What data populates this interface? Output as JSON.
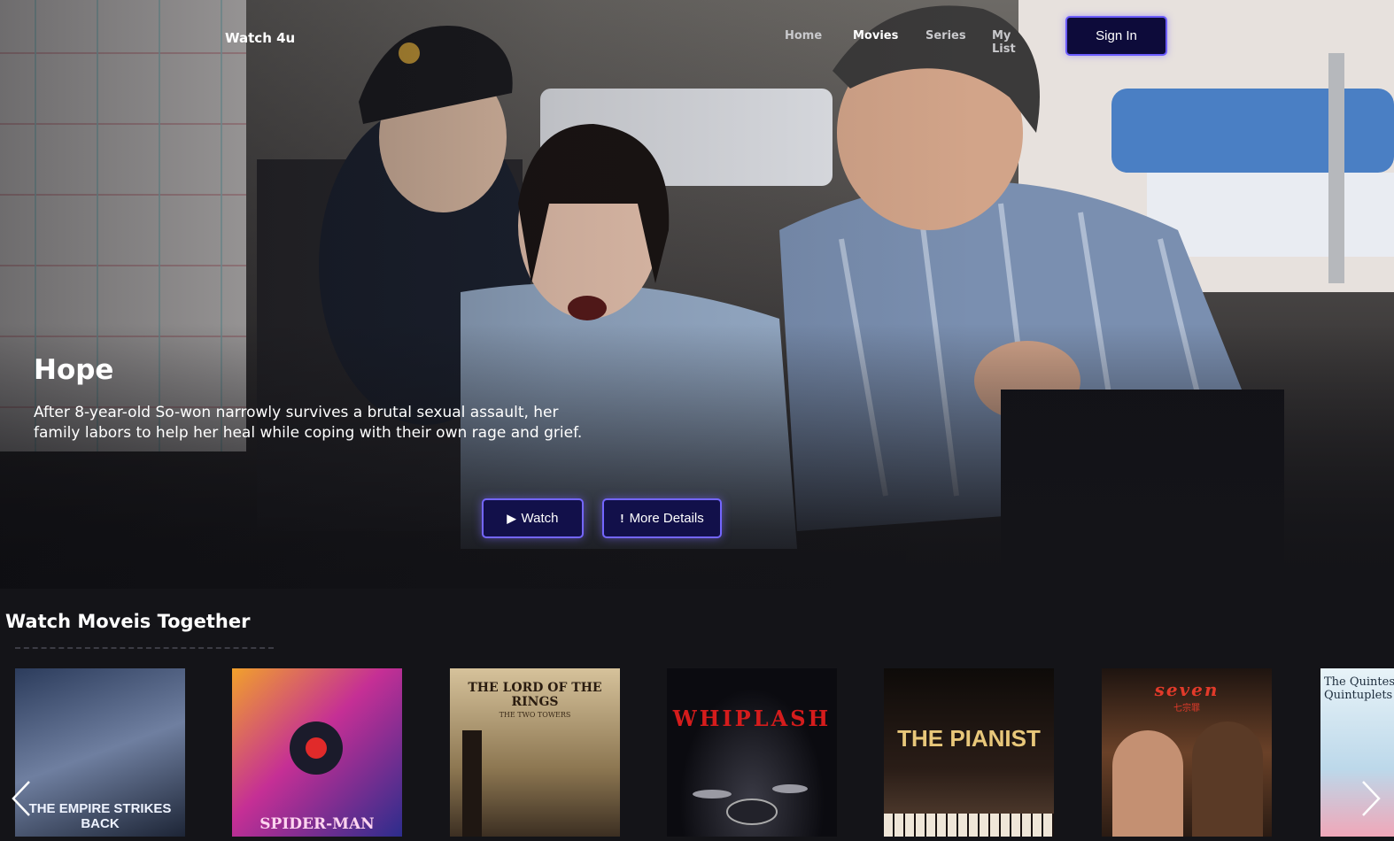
{
  "brand": "Watch 4u",
  "nav": {
    "home": "Home",
    "movies": "Movies",
    "series": "Series",
    "my_list": "My List"
  },
  "signin_label": "Sign In",
  "hero": {
    "title": "Hope",
    "description": "After 8-year-old So-won narrowly survives a brutal sexual assault, her family labors to help her heal while coping with their own rage and grief.",
    "watch_label": "Watch",
    "more_label": "More Details",
    "watch_glyph": "▶",
    "more_glyph": "!"
  },
  "row": {
    "title": "Watch Moveis Together",
    "posters": [
      {
        "title": "THE EMPIRE STRIKES BACK",
        "icon": "empire-poster",
        "bg": "#5a6a86"
      },
      {
        "title": "SPIDER-MAN",
        "icon": "spiderman-poster",
        "bg": "#c2359a"
      },
      {
        "title": "THE LORD OF THE RINGS",
        "sub": "THE TWO TOWERS",
        "icon": "lotr-poster",
        "bg": "#b3986c"
      },
      {
        "title": "WHIPLASH",
        "icon": "whiplash-poster",
        "bg": "#0b0b10"
      },
      {
        "title": "THE PIANIST",
        "icon": "pianist-poster",
        "bg": "#1b1512"
      },
      {
        "title": "seven",
        "sub": "七宗罪",
        "icon": "seven-poster",
        "bg": "#3a2418"
      },
      {
        "title": "The Quintessential Quintuplets",
        "icon": "quintuplets-poster",
        "bg": "#cfe6f2"
      }
    ]
  },
  "colors": {
    "accent": "#6b5cff",
    "button_bg": "#0d0b3a",
    "page_bg": "#141418"
  }
}
